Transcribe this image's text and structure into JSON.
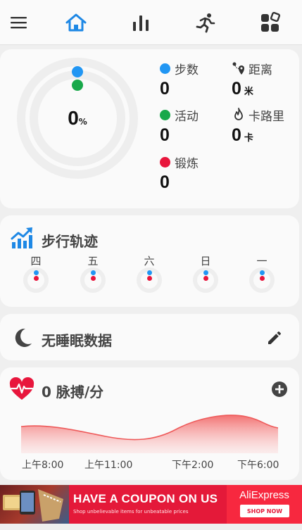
{
  "topbar": {
    "icons": [
      "menu-icon",
      "home-icon",
      "chart-icon",
      "running-icon",
      "widgets-icon"
    ],
    "active_color": "#1e88e5",
    "inactive_color": "#333333"
  },
  "activity_ring": {
    "percent": "0",
    "percent_unit": "%",
    "colors": {
      "track": "#eeeeee",
      "steps": "#2196f3",
      "active": "#18a84a"
    }
  },
  "stats": {
    "steps": {
      "label": "步数",
      "value": "0",
      "color": "#2196f3"
    },
    "distance": {
      "label": "距离",
      "value": "0",
      "unit": "米"
    },
    "active": {
      "label": "活动",
      "value": "0",
      "color": "#18a84a"
    },
    "calories": {
      "label": "卡路里",
      "value": "0",
      "unit": "卡"
    },
    "exercise": {
      "label": "锻炼",
      "value": "0",
      "color": "#e8163c"
    }
  },
  "walk_track": {
    "title": "步行轨迹",
    "days": [
      "四",
      "五",
      "六",
      "日",
      "一"
    ]
  },
  "sleep": {
    "title": "无睡眠数据"
  },
  "heart": {
    "title": "0 脉搏/分",
    "x_labels": [
      "上午8:00",
      "上午11:00",
      "下午2:00",
      "下午6:00"
    ]
  },
  "ad": {
    "headline": "HAVE A COUPON ON US",
    "subline": "Shop unbelievable items for unbeatable prices",
    "brand": "AliExpress",
    "cta": "SHOP NOW"
  }
}
